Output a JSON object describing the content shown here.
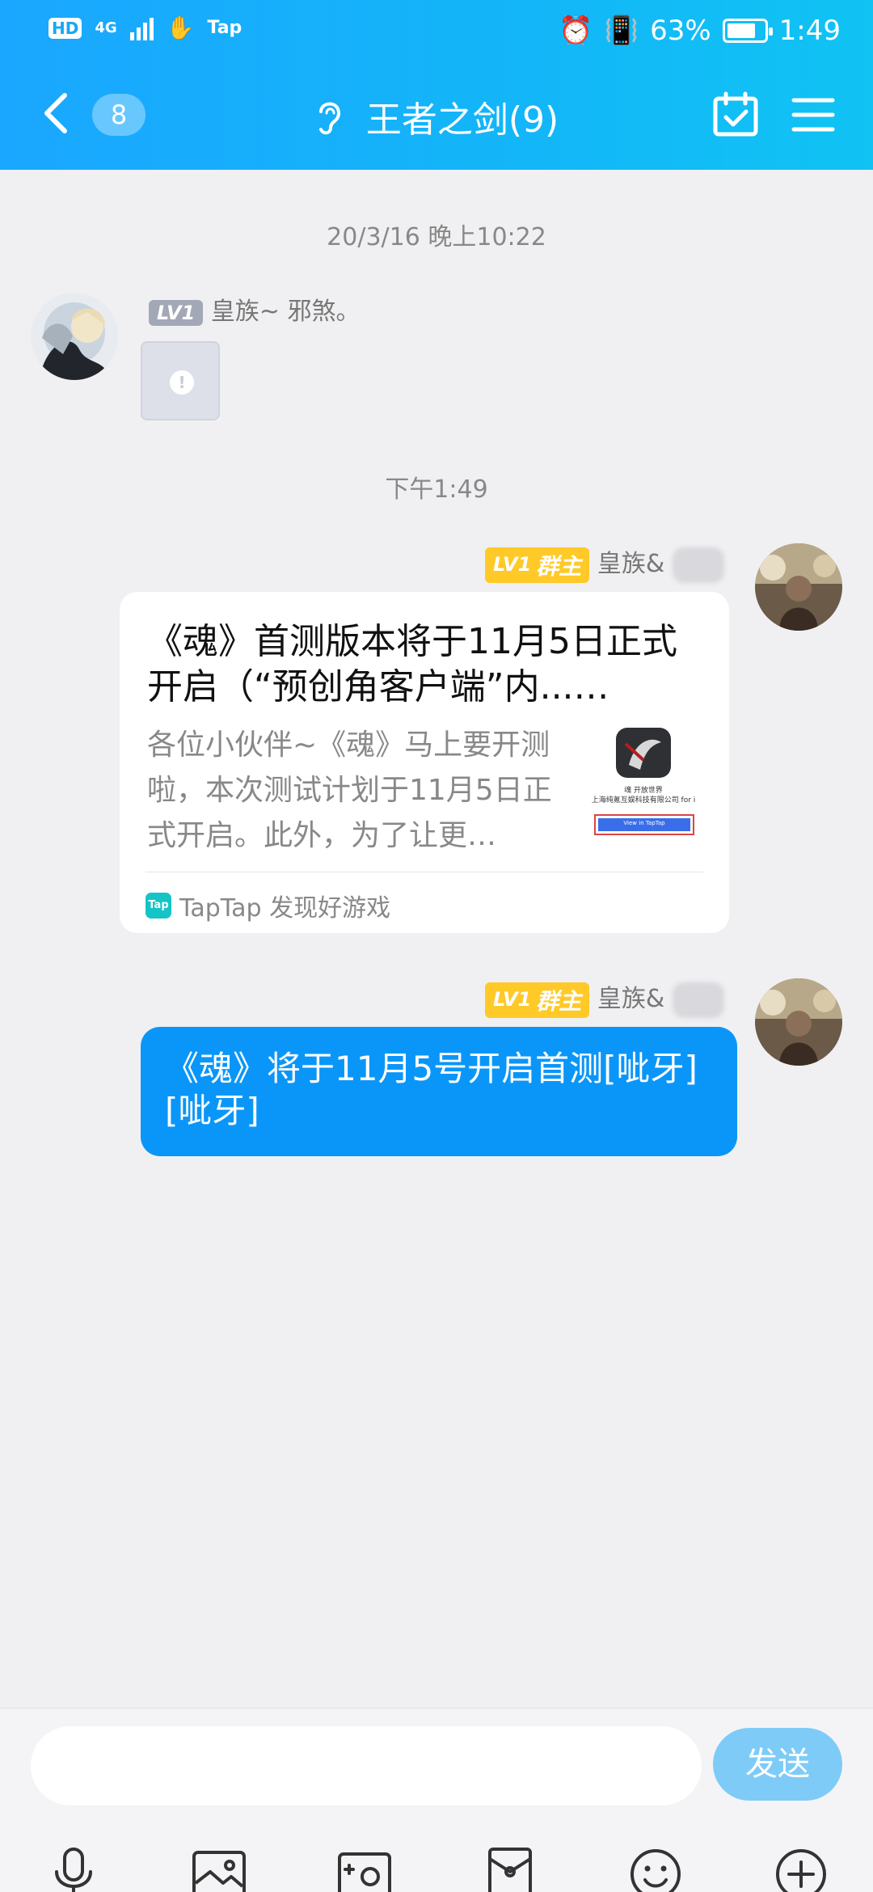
{
  "status_bar": {
    "hd": "HD",
    "network": "4G",
    "app_label": "Tap",
    "battery": "63%",
    "time": "1:49"
  },
  "header": {
    "unread_count": "8",
    "title": "王者之剑(9)"
  },
  "messages": {
    "time1": "20/3/16 晚上10:22",
    "msg1": {
      "level": "LV1",
      "sender": "皇族~ 邪煞。"
    },
    "time2": "下午1:49",
    "msg2": {
      "level": "LV1",
      "role": "群主",
      "sender": "皇族&",
      "card": {
        "title": "《魂》首测版本将于11月5日正式开启（“预创角客户端”内...…",
        "desc": "各位小伙伴~《魂》马上要开测啦，本次测试计划于11月5日正式开启。此外，为了让更…",
        "thumb_caption": "魂 开放世界",
        "thumb_sub": "上海纯氪互娱科技有限公司 for i",
        "thumb_button": "View in TapTap",
        "source_logo": "Tap",
        "source": "TapTap 发现好游戏"
      }
    },
    "msg3": {
      "level": "LV1",
      "role": "群主",
      "sender": "皇族&",
      "text": "《魂》将于11月5号开启首测[呲牙][呲牙]"
    }
  },
  "input": {
    "placeholder": "",
    "send_label": "发送"
  },
  "colors": {
    "header_blue": "#1aa7ff",
    "bubble_blue": "#0a96f9",
    "owner_badge": "#ffc928",
    "send_button": "#7ecbf7"
  }
}
